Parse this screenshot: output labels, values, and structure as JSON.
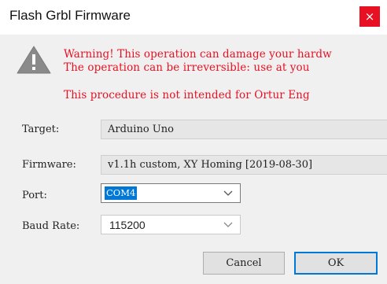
{
  "dialog": {
    "title": "Flash Grbl Firmware",
    "close_glyph": "×",
    "accent": "#0078d7",
    "close_color": "#e81123"
  },
  "warning": {
    "icon": "warning-icon",
    "line1": "Warning! This operation can damage your hardw",
    "line2": "The operation can be irreversible: use at you",
    "line3": "This procedure is not intended for Ortur Eng",
    "color": "#e81123"
  },
  "form": {
    "target": {
      "label": "Target:",
      "value": "Arduino Uno"
    },
    "firmware": {
      "label": "Firmware:",
      "value": "v1.1h custom, XY Homing [2019-08-30]"
    },
    "port": {
      "label": "Port:",
      "value": "COM4"
    },
    "baud": {
      "label": "Baud Rate:",
      "value": "115200"
    }
  },
  "buttons": {
    "cancel": "Cancel",
    "ok": "OK"
  }
}
